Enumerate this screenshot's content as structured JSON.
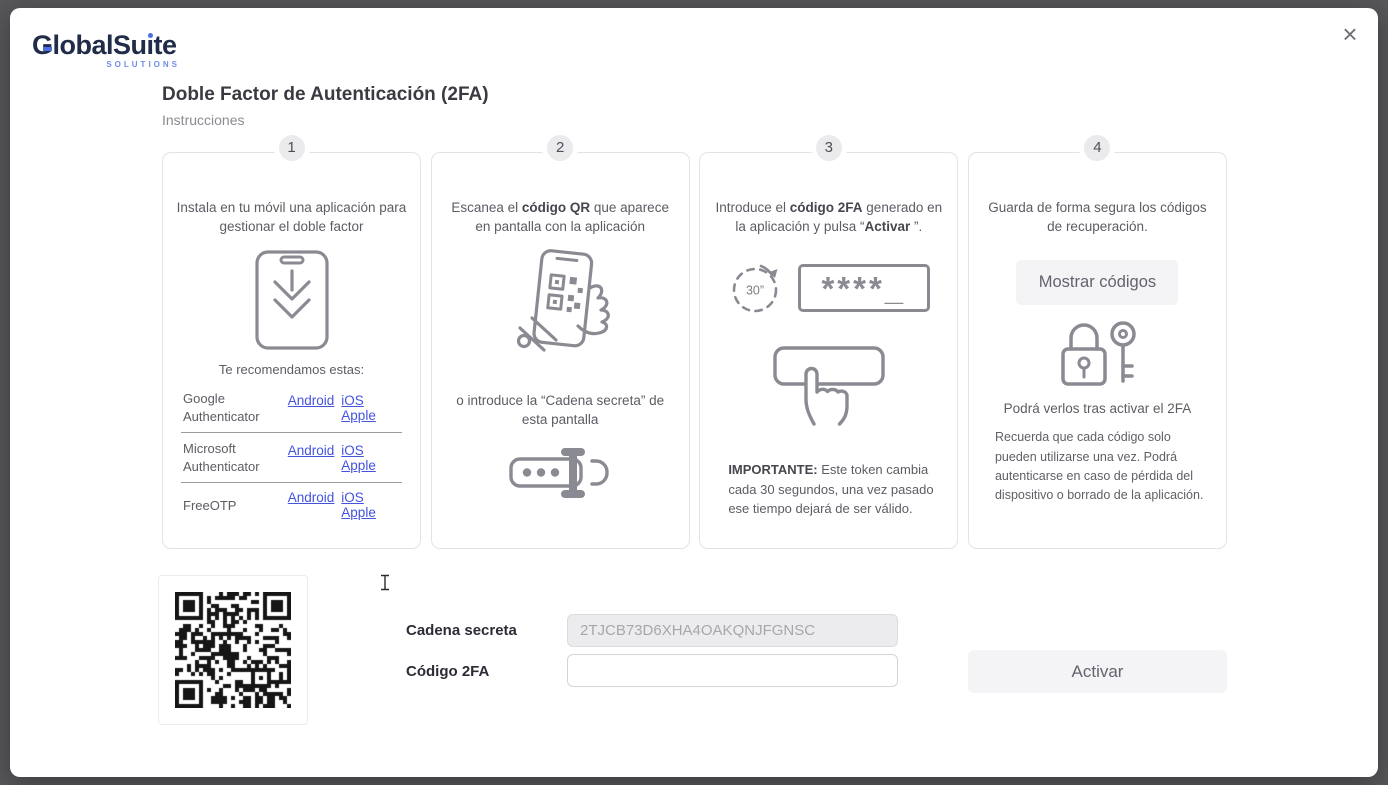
{
  "colors": {
    "link_blue": "#4353de",
    "logo_navy": "#202c48",
    "logo_blue": "#4f6fe0",
    "icon_gray": "#8a8a93"
  },
  "window": {
    "close_icon": "×"
  },
  "logo": {
    "name": "GlobalSuite",
    "tagline": "SOLUTIONS"
  },
  "header": {
    "title": "Doble Factor de Autenticación (2FA)",
    "subtitle": "Instrucciones"
  },
  "steps": {
    "one": {
      "number": "1",
      "text": "Instala en tu móvil una aplicación para gestionar el doble factor",
      "recommend": "Te recomendamos estas:",
      "apps": [
        {
          "name": "Google Authenticator",
          "link1": "Android",
          "link2": "iOS Apple"
        },
        {
          "name": "Microsoft Authenticator",
          "link1": "Android",
          "link2": "iOS Apple"
        },
        {
          "name": "FreeOTP",
          "link1": "Android",
          "link2": "iOS Apple"
        }
      ]
    },
    "two": {
      "number": "2",
      "text_pre": "Escanea el ",
      "text_bold": "código QR",
      "text_post": " que aparece en pantalla con la aplicación",
      "alt_text": "o introduce la “Cadena secreta” de esta pantalla"
    },
    "three": {
      "number": "3",
      "text_pre": "Introduce el ",
      "text_bold": "código 2FA",
      "text_mid": " generado en la aplicación y pulsa “",
      "text_bold2": "Activar",
      "text_post": " ”.",
      "timer_label": "30”",
      "code_preview": "****_",
      "important_label": "IMPORTANTE:",
      "important_text": " Este token cambia cada 30 segundos, una vez pasado ese tiempo dejará de ser válido."
    },
    "four": {
      "number": "4",
      "text": "Guarda de forma segura los códigos de recuperación.",
      "show_codes_button": "Mostrar códigos",
      "after_note": "Podrá verlos tras activar el 2FA",
      "detail": "Recuerda que cada código solo pueden utilizarse una vez. Podrá autenticarse en caso de pérdida del dispositivo o borrado de la aplicación."
    }
  },
  "form": {
    "secret_label": "Cadena secreta",
    "secret_value": "2TJCB73D6XHA4OAKQNJFGNSC",
    "code_label": "Código 2FA",
    "code_value": "",
    "activate_button": "Activar"
  }
}
